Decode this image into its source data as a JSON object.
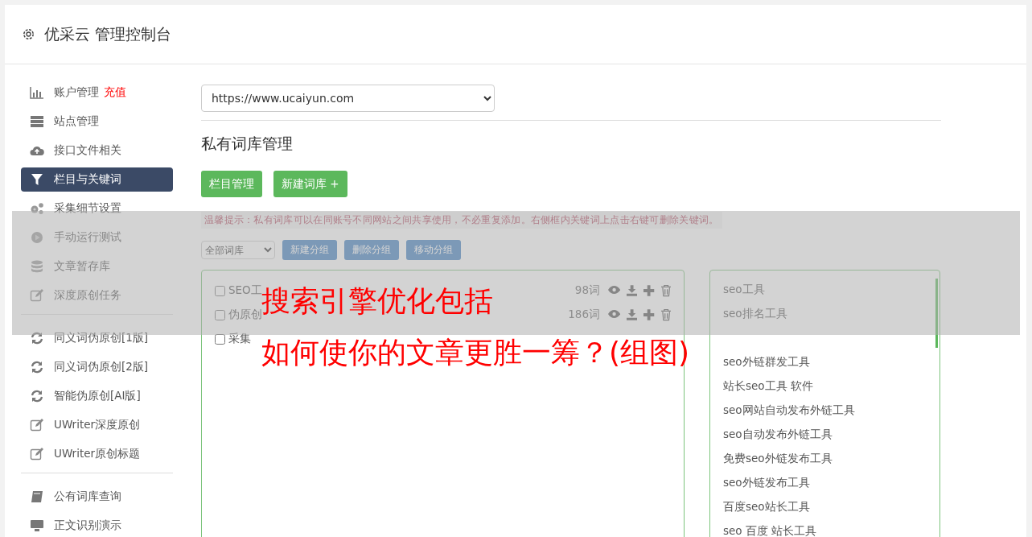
{
  "header": {
    "title": "优采云 管理控制台"
  },
  "sidebar": {
    "groups": [
      [
        {
          "label": "账户管理",
          "badge": "充值",
          "selected": false
        },
        {
          "label": "站点管理",
          "selected": false
        },
        {
          "label": "接口文件相关",
          "selected": false
        },
        {
          "label": "栏目与关键词",
          "selected": true
        },
        {
          "label": "采集细节设置",
          "selected": false
        },
        {
          "label": "手动运行测试",
          "selected": false
        },
        {
          "label": "文章暂存库",
          "selected": false
        },
        {
          "label": "深度原创任务",
          "selected": false
        }
      ],
      [
        {
          "label": "同义词伪原创[1版]",
          "selected": false
        },
        {
          "label": "同义词伪原创[2版]",
          "selected": false
        },
        {
          "label": "智能伪原创[AI版]",
          "selected": false
        },
        {
          "label": "UWriter深度原创",
          "selected": false
        },
        {
          "label": "UWriter原创标题",
          "selected": false
        }
      ],
      [
        {
          "label": "公有词库查询",
          "selected": false
        },
        {
          "label": "正文识别演示",
          "selected": false
        }
      ]
    ]
  },
  "site_select": {
    "value": "https://www.ucaiyun.com"
  },
  "heading": "私有词库管理",
  "buttons": [
    "栏目管理",
    "新建词库 +"
  ],
  "tip": "温馨提示：私有词库可以在同账号不同网站之间共享使用，不必重复添加。右侧框内关键词上点击右键可删除关键词。",
  "group_select": {
    "value": "全部词库"
  },
  "group_buttons": [
    "新建分组",
    "删除分组",
    "移动分组"
  ],
  "libraries": [
    {
      "name": "SEO工",
      "count": "98词",
      "checked": false
    },
    {
      "name": "伪原创",
      "count": "186词",
      "checked": false
    },
    {
      "name": "采集",
      "checked": false
    }
  ],
  "keywords_top": [
    "seo工具",
    "seo排名工具"
  ],
  "keywords": [
    "seo外链群发工具",
    "站长seo工具 软件",
    "seo网站自动发布外链工具",
    "seo自动发布外链工具",
    "免费seo外链发布工具",
    "seo外链发布工具",
    "百度seo站长工具",
    "seo 百度 站长工具"
  ],
  "overlay": {
    "lines": [
      "搜索引擎优化包括",
      "如何使你的文章更胜一筹？(组图)"
    ]
  }
}
